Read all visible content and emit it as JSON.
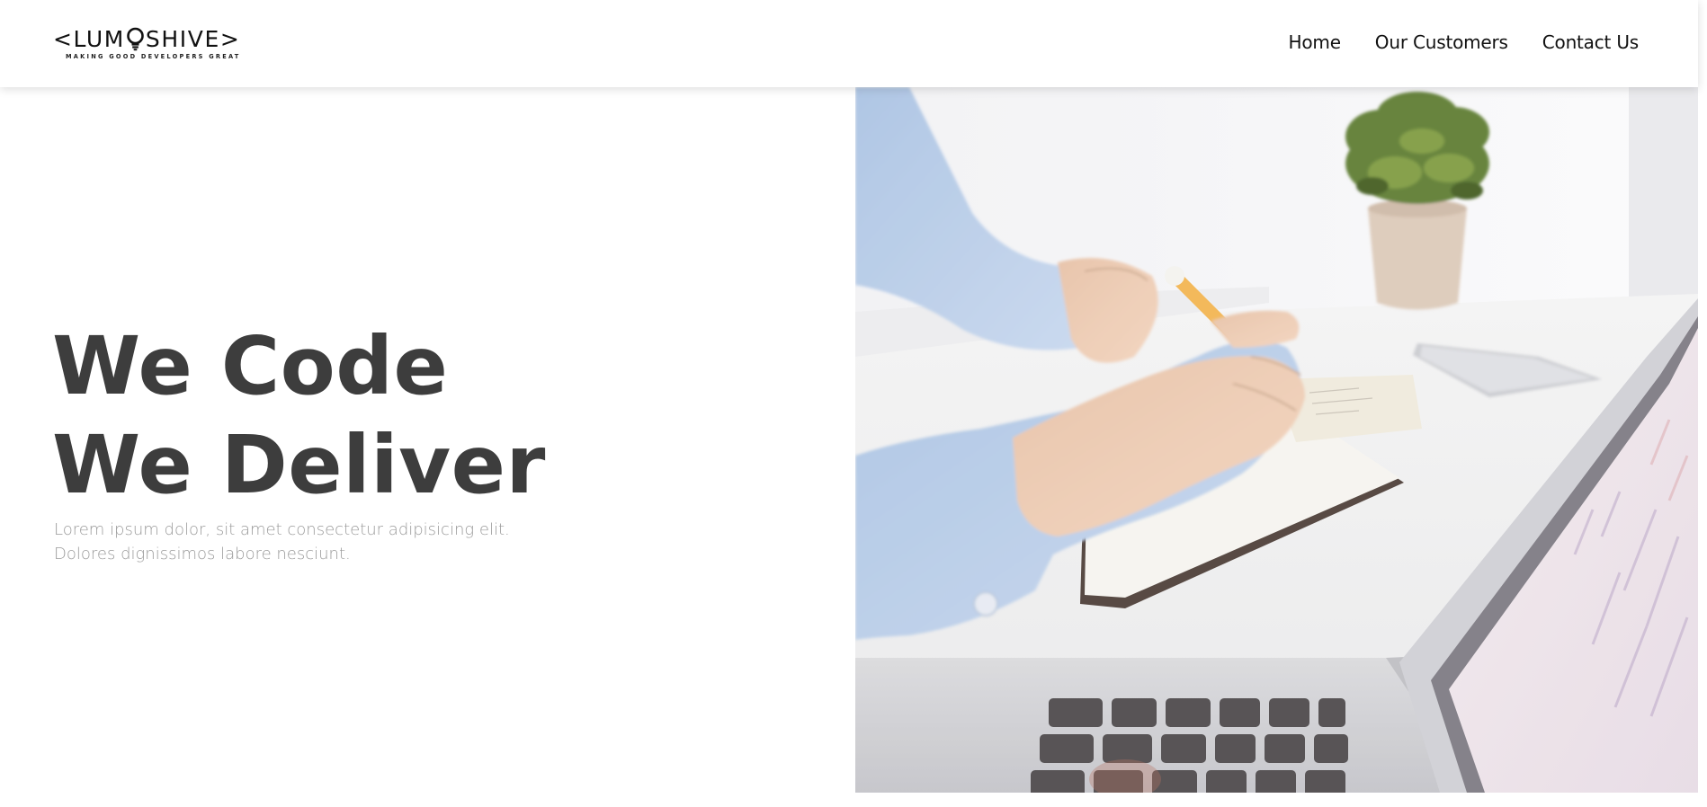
{
  "header": {
    "logo": {
      "wordmark_left": "<LUM",
      "wordmark_right": "SHIVE>",
      "tagline": "MAKING GOOD DEVELOPERS GREAT"
    },
    "nav": {
      "items": [
        {
          "label": "Home"
        },
        {
          "label": "Our Customers"
        },
        {
          "label": "Contact Us"
        }
      ]
    }
  },
  "hero": {
    "heading_line1": "We Code",
    "heading_line2": "We Deliver",
    "subtitle_line1": "Lorem ipsum dolor, sit amet consectetur adipisicing elit.",
    "subtitle_line2": "Dolores dignissimos labore nesciunt.",
    "image": {
      "description_icon": "desk-workspace-photo"
    }
  },
  "colors": {
    "heading": "#3d3d3d",
    "subtitle": "#9b9b9b",
    "nav_text": "#111111",
    "header_bg": "#ffffff"
  }
}
